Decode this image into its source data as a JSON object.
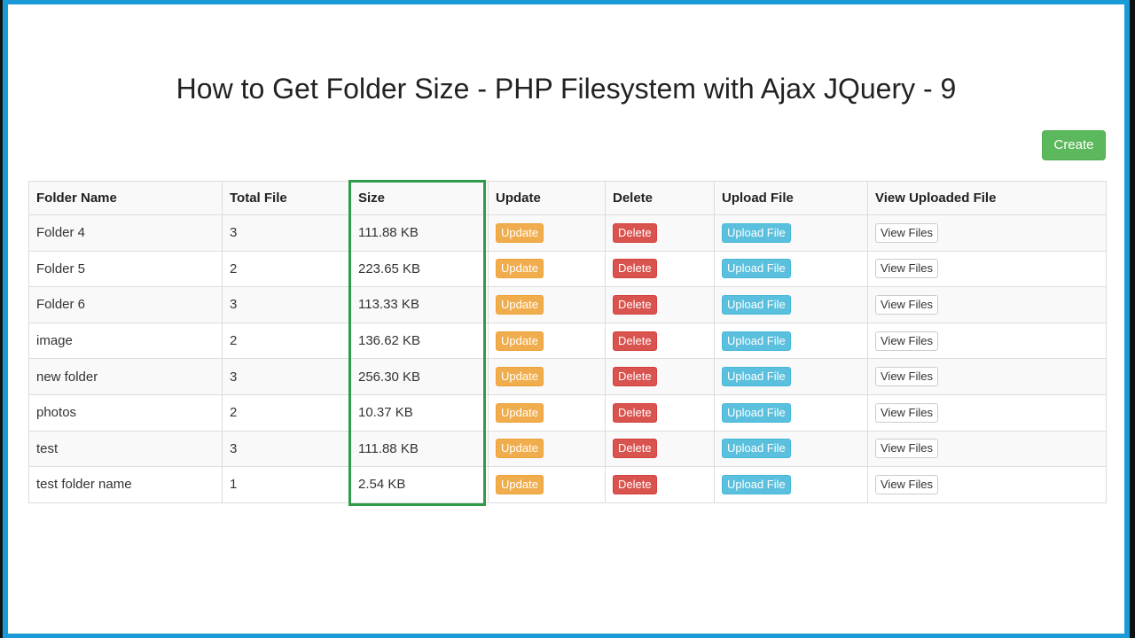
{
  "page": {
    "title": "How to Get Folder Size - PHP Filesystem with Ajax JQuery - 9",
    "create_button": "Create"
  },
  "colors": {
    "frame": "#1a9ad6",
    "create": "#5cb85c",
    "update": "#f0ad4e",
    "delete": "#d9534f",
    "upload": "#5bc0de",
    "highlight": "#2e9c4b"
  },
  "table": {
    "headers": [
      "Folder Name",
      "Total File",
      "Size",
      "Update",
      "Delete",
      "Upload File",
      "View Uploaded File"
    ],
    "button_labels": {
      "update": "Update",
      "delete": "Delete",
      "upload": "Upload File",
      "view": "View Files"
    },
    "rows": [
      {
        "name": "Folder 4",
        "total": "3",
        "size": "111.88 KB"
      },
      {
        "name": "Folder 5",
        "total": "2",
        "size": "223.65 KB"
      },
      {
        "name": "Folder 6",
        "total": "3",
        "size": "113.33 KB"
      },
      {
        "name": "image",
        "total": "2",
        "size": "136.62 KB"
      },
      {
        "name": "new folder",
        "total": "3",
        "size": "256.30 KB"
      },
      {
        "name": "photos",
        "total": "2",
        "size": "10.37 KB"
      },
      {
        "name": "test",
        "total": "3",
        "size": "111.88 KB"
      },
      {
        "name": "test folder name",
        "total": "1",
        "size": "2.54 KB"
      }
    ]
  }
}
